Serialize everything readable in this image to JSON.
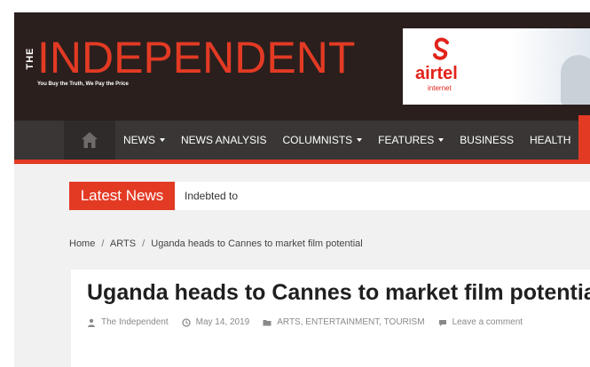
{
  "header": {
    "logo_the": "THE",
    "logo_name": "INDEPENDENT",
    "tagline": "You Buy the Truth, We Pay the Price",
    "ad": {
      "brand": "airtel",
      "sub": "internet"
    }
  },
  "nav": {
    "items": [
      {
        "label": "NEWS",
        "dropdown": true
      },
      {
        "label": "NEWS ANALYSIS",
        "dropdown": false
      },
      {
        "label": "COLUMNISTS",
        "dropdown": true
      },
      {
        "label": "FEATURES",
        "dropdown": true
      },
      {
        "label": "BUSINESS",
        "dropdown": false
      },
      {
        "label": "HEALTH",
        "dropdown": false
      }
    ]
  },
  "ticker": {
    "label": "Latest News",
    "text": "Indebted to"
  },
  "breadcrumb": {
    "home": "Home",
    "section": "ARTS",
    "current": "Uganda heads to Cannes to market film potential",
    "separator": "/"
  },
  "article": {
    "title": "Uganda heads to Cannes to market film potential",
    "author": "The Independent",
    "date": "May 14, 2019",
    "categories": "ARTS, ENTERTAINMENT, TOURISM",
    "comment": "Leave a comment"
  },
  "colors": {
    "brand_red": "#e33a24",
    "header_bg": "#2a1f1d",
    "nav_bg": "#3a3635",
    "airtel_red": "#e2231a"
  }
}
